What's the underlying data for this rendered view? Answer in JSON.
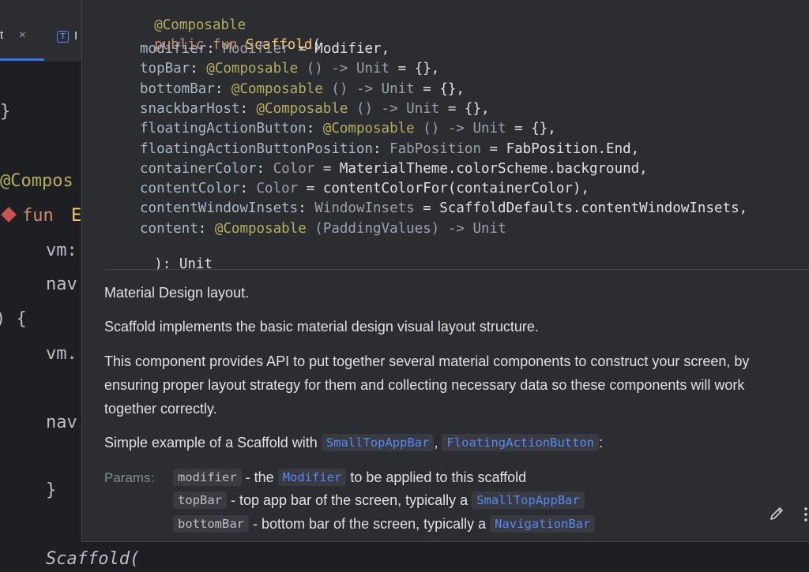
{
  "tabs": {
    "active_label": "t",
    "active_close": "×",
    "second_icon_letter": "T",
    "second_label": "I"
  },
  "editor": {
    "lines": {
      "close_brace": "}",
      "annotation": "@Compos",
      "fun_kw": "fun",
      "fun_name": "E",
      "vm": "vm:",
      "nav1": "nav",
      "paren_brace": ") {",
      "vm_dot": "vm.",
      "nav2": "nav",
      "close_brace2": "}",
      "scaffold_call": "Scaffold("
    }
  },
  "doc": {
    "signature": {
      "annotation": "@Composable",
      "decl_kw": "public fun",
      "decl_name": "Scaffold",
      "decl_open": "(",
      "params": [
        {
          "name": "modifier",
          "sep": ": ",
          "anno": "",
          "type": "Modifier",
          "rest": " = Modifier,"
        },
        {
          "name": "topBar",
          "sep": ": ",
          "anno": "@Composable",
          "type": " () -> Unit",
          "rest": " = {},"
        },
        {
          "name": "bottomBar",
          "sep": ": ",
          "anno": "@Composable",
          "type": " () -> Unit",
          "rest": " = {},"
        },
        {
          "name": "snackbarHost",
          "sep": ": ",
          "anno": "@Composable",
          "type": " () -> Unit",
          "rest": " = {},"
        },
        {
          "name": "floatingActionButton",
          "sep": ": ",
          "anno": "@Composable",
          "type": " () -> Unit",
          "rest": " = {},"
        },
        {
          "name": "floatingActionButtonPosition",
          "sep": ": ",
          "anno": "",
          "type": "FabPosition",
          "rest": " = FabPosition.End,"
        },
        {
          "name": "containerColor",
          "sep": ": ",
          "anno": "",
          "type": "Color",
          "rest": " = MaterialTheme.colorScheme.background,"
        },
        {
          "name": "contentColor",
          "sep": ": ",
          "anno": "",
          "type": "Color",
          "rest": " = contentColorFor(containerColor),"
        },
        {
          "name": "contentWindowInsets",
          "sep": ": ",
          "anno": "",
          "type": "WindowInsets",
          "rest": " = ScaffoldDefaults.contentWindowInsets,"
        },
        {
          "name": "content",
          "sep": ": ",
          "anno": "@Composable",
          "type": " (PaddingValues) -> Unit",
          "rest": ""
        }
      ],
      "close": "): Unit"
    },
    "paragraphs": {
      "p1": "Material Design layout.",
      "p2": "Scaffold implements the basic material design visual layout structure.",
      "p3": "This component provides API to put together several material components to construct your screen, by ensuring proper layout strategy for them and collecting necessary data so these components will work together correctly.",
      "p4_prefix": "Simple example of a Scaffold with ",
      "p4_chip1": "SmallTopAppBar",
      "p4_comma": ", ",
      "p4_chip2": "FloatingActionButton",
      "p4_suffix": ":"
    },
    "params": {
      "label": "Params:",
      "rows": [
        {
          "name": "modifier",
          "text1": " - the ",
          "link": "Modifier",
          "text2": " to be applied to this scaffold"
        },
        {
          "name": "topBar",
          "text1": " - top app bar of the screen, typically a ",
          "link": "SmallTopAppBar",
          "text2": ""
        },
        {
          "name": "bottomBar",
          "text1": " - bottom bar of the screen, typically a ",
          "link": "NavigationBar",
          "text2": ""
        }
      ]
    }
  },
  "colors": {
    "accent_blue": "#548af7",
    "keyword": "#cf8e6d",
    "annotation": "#b3ae60",
    "function_name": "#ffc66d",
    "popup_bg": "#2b2d30",
    "editor_bg": "#1e1f22"
  },
  "icons": {
    "edit": "pencil-icon",
    "more": "more-vertical-icon",
    "close": "close-icon",
    "gutter": "breakpoint-diamond-icon"
  }
}
